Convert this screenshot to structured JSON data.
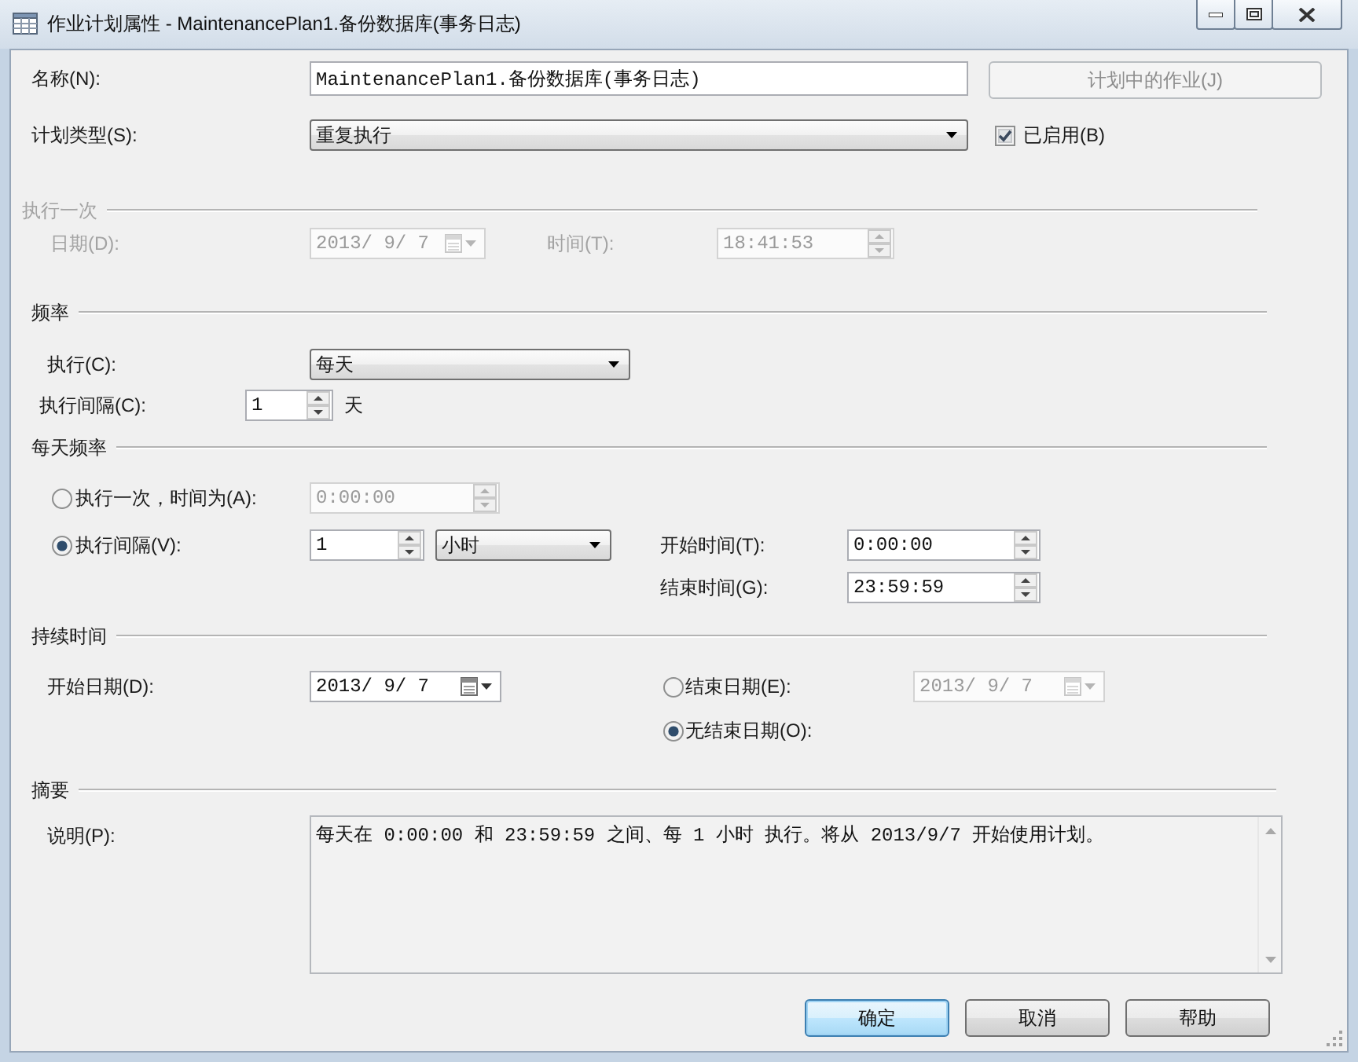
{
  "window": {
    "title": "作业计划属性 - MaintenancePlan1.备份数据库(事务日志)"
  },
  "name": {
    "label": "名称(N):",
    "value": "MaintenancePlan1.备份数据库(事务日志)"
  },
  "jobs_button": {
    "label": "计划中的作业(J)",
    "disabled": true
  },
  "schedule_type": {
    "label": "计划类型(S):",
    "value": "重复执行"
  },
  "enabled": {
    "label": "已启用(B)",
    "checked": true
  },
  "one_time": {
    "title": "执行一次",
    "disabled": true,
    "date": {
      "label": "日期(D):",
      "value": "2013/ 9/ 7"
    },
    "time": {
      "label": "时间(T):",
      "value": "18:41:53"
    }
  },
  "frequency": {
    "title": "频率",
    "occurs": {
      "label": "执行(C):",
      "value": "每天"
    },
    "recurs": {
      "label": "执行间隔(C):",
      "value": "1",
      "unit": "天"
    }
  },
  "daily_frequency": {
    "title": "每天频率",
    "options": [
      {
        "kind": "once",
        "label": "执行一次，时间为(A):",
        "selected": false,
        "value": "0:00:00"
      },
      {
        "kind": "interval",
        "label": "执行间隔(V):",
        "selected": true,
        "value": "1",
        "unit": "小时"
      }
    ],
    "start_time": {
      "label": "开始时间(T):",
      "value": "0:00:00"
    },
    "end_time": {
      "label": "结束时间(G):",
      "value": "23:59:59"
    }
  },
  "duration": {
    "title": "持续时间",
    "start_date": {
      "label": "开始日期(D):",
      "value": "2013/ 9/ 7"
    },
    "end_options": [
      {
        "kind": "date",
        "label": "结束日期(E):",
        "selected": false,
        "value": "2013/ 9/ 7"
      },
      {
        "kind": "none",
        "label": "无结束日期(O):",
        "selected": true
      }
    ]
  },
  "summary": {
    "title": "摘要",
    "label": "说明(P):",
    "text": "每天在 0:00:00 和 23:59:59 之间、每 1 小时 执行。将从 2013/9/7 开始使用计划。"
  },
  "buttons": [
    {
      "label": "确定",
      "default": true
    },
    {
      "label": "取消",
      "default": false
    },
    {
      "label": "帮助",
      "default": false
    }
  ]
}
